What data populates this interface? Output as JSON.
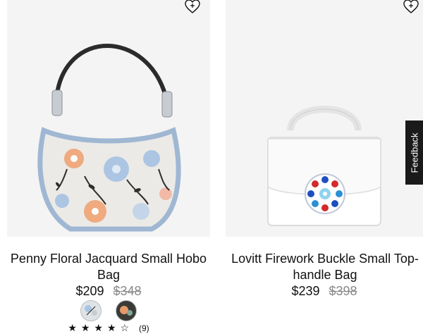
{
  "products": [
    {
      "title": "Penny Floral Jacquard Small Hobo Bag",
      "price_now": "$209",
      "price_was": "$348",
      "image_icon": "hobo-bag-floral-image",
      "swatches": [
        {
          "name": "light-floral",
          "color": "#dfe3e6"
        },
        {
          "name": "dark-floral",
          "color": "#3a3a36"
        }
      ],
      "rating": {
        "stars": "★★★★☆",
        "count": "(9)"
      }
    },
    {
      "title": "Lovitt Firework Buckle Small Top-handle Bag",
      "price_now": "$239",
      "price_was": "$398",
      "image_icon": "top-handle-bag-white-image"
    }
  ],
  "feedback": {
    "label": "Feedback"
  },
  "colors": {
    "hobo_trim": "#9fb7d3",
    "bag_white": "#ffffff",
    "feedback_bg": "#1a1a1a"
  }
}
